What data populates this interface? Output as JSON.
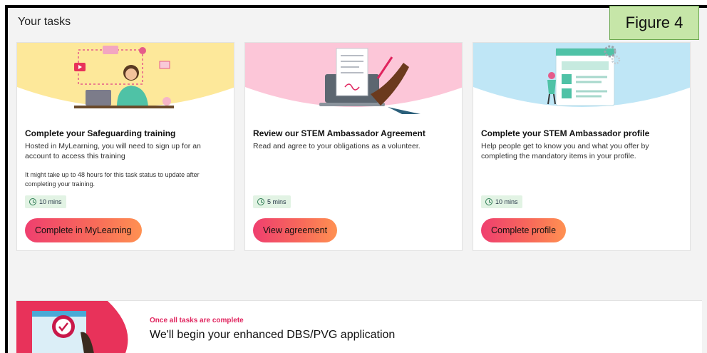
{
  "header": {
    "title": "Your tasks"
  },
  "figure_label": "Figure 4",
  "cards": [
    {
      "title": "Complete your Safeguarding training",
      "description": "Hosted in MyLearning, you will need to sign up for an account to access this training",
      "note": "It might take up to 48 hours for this task status to update after completing your training.",
      "duration": "10 mins",
      "cta": "Complete in MyLearning",
      "banner_color": "#fde89a"
    },
    {
      "title": "Review our STEM Ambassador Agreement",
      "description": "Read and agree to your obligations as a volunteer.",
      "note": "",
      "duration": "5 mins",
      "cta": "View agreement",
      "banner_color": "#fcc6d8"
    },
    {
      "title": "Complete your STEM Ambassador profile",
      "description": "Help people get to know you and what you offer by completing the mandatory items in your profile.",
      "note": "",
      "duration": "10 mins",
      "cta": "Complete profile",
      "banner_color": "#bfe6f6"
    }
  ],
  "bottom": {
    "kicker": "Once all tasks are complete",
    "title": "We'll begin your enhanced DBS/PVG application"
  },
  "colors": {
    "accent_pink": "#e0245e",
    "button_gradient_start": "#ef3f6f",
    "button_gradient_end": "#ff9152",
    "duration_badge": "#e2f3e4"
  }
}
